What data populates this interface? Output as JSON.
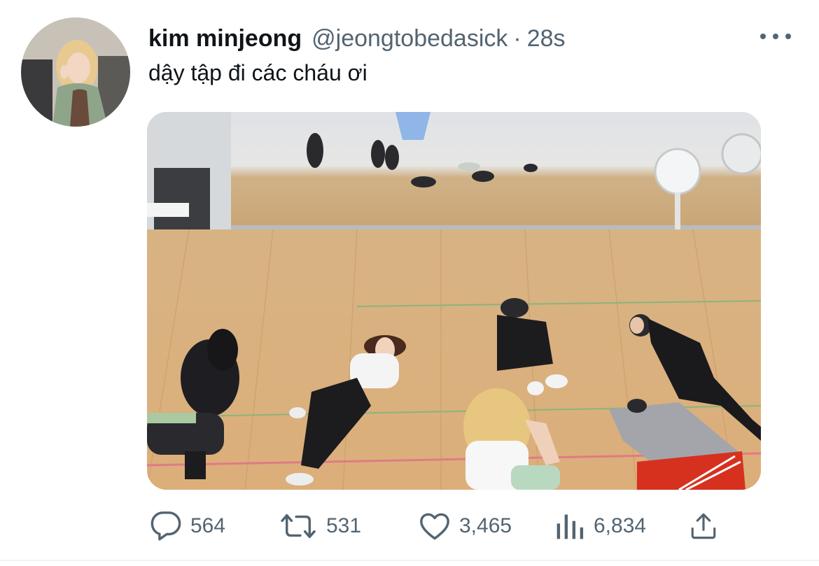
{
  "tweet": {
    "display_name": "kim minjeong",
    "handle": "@jeongtobedasick",
    "separator": "·",
    "time": "28s",
    "text": "dậy tập đi các cháu ơi"
  },
  "actions": {
    "replies": "564",
    "retweets": "531",
    "likes": "3,465",
    "views": "6,834"
  },
  "icons": {
    "more": "more-horizontal-icon",
    "reply": "speech-bubble-icon",
    "retweet": "retweet-arrows-icon",
    "like": "heart-icon",
    "views": "bar-chart-icon",
    "share": "share-upload-icon"
  },
  "colors": {
    "text": "#0f1419",
    "secondary": "#536471",
    "floor": "#d9b17e"
  }
}
